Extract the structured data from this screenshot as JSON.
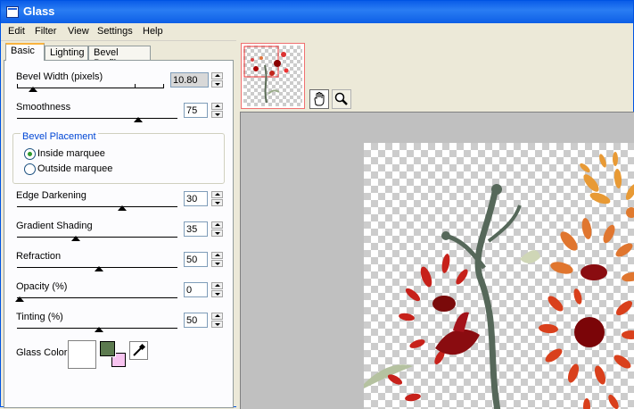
{
  "window": {
    "title": "Glass"
  },
  "menu": [
    "Edit",
    "Filter",
    "View",
    "Settings",
    "Help"
  ],
  "tabs": [
    "Basic",
    "Lighting",
    "Bevel Profile"
  ],
  "active_tab": "Basic",
  "basic": {
    "bevel_width": {
      "label": "Bevel Width (pixels)",
      "value": "10.80"
    },
    "smoothness": {
      "label": "Smoothness",
      "value": "75"
    },
    "bevel_placement": {
      "label": "Bevel Placement",
      "options": [
        "Inside marquee",
        "Outside marquee"
      ],
      "selected": "Inside marquee"
    },
    "edge_darkening": {
      "label": "Edge Darkening",
      "value": "30"
    },
    "gradient_shading": {
      "label": "Gradient Shading",
      "value": "35"
    },
    "refraction": {
      "label": "Refraction",
      "value": "50"
    },
    "opacity": {
      "label": "Opacity (%)",
      "value": "0"
    },
    "tinting": {
      "label": "Tinting (%)",
      "value": "50"
    },
    "glass_color": {
      "label": "Glass Color",
      "swatch": "#ffffff",
      "foreground": "#5c7a4f",
      "background": "#f8c4f0"
    }
  },
  "preview": {
    "tools": [
      "hand-icon",
      "zoom-icon"
    ],
    "active_tool": "hand-icon"
  },
  "colors": {
    "accent": "#0a5ce8",
    "tab_highlight": "#f9b33f",
    "group_label": "#0046d5"
  }
}
